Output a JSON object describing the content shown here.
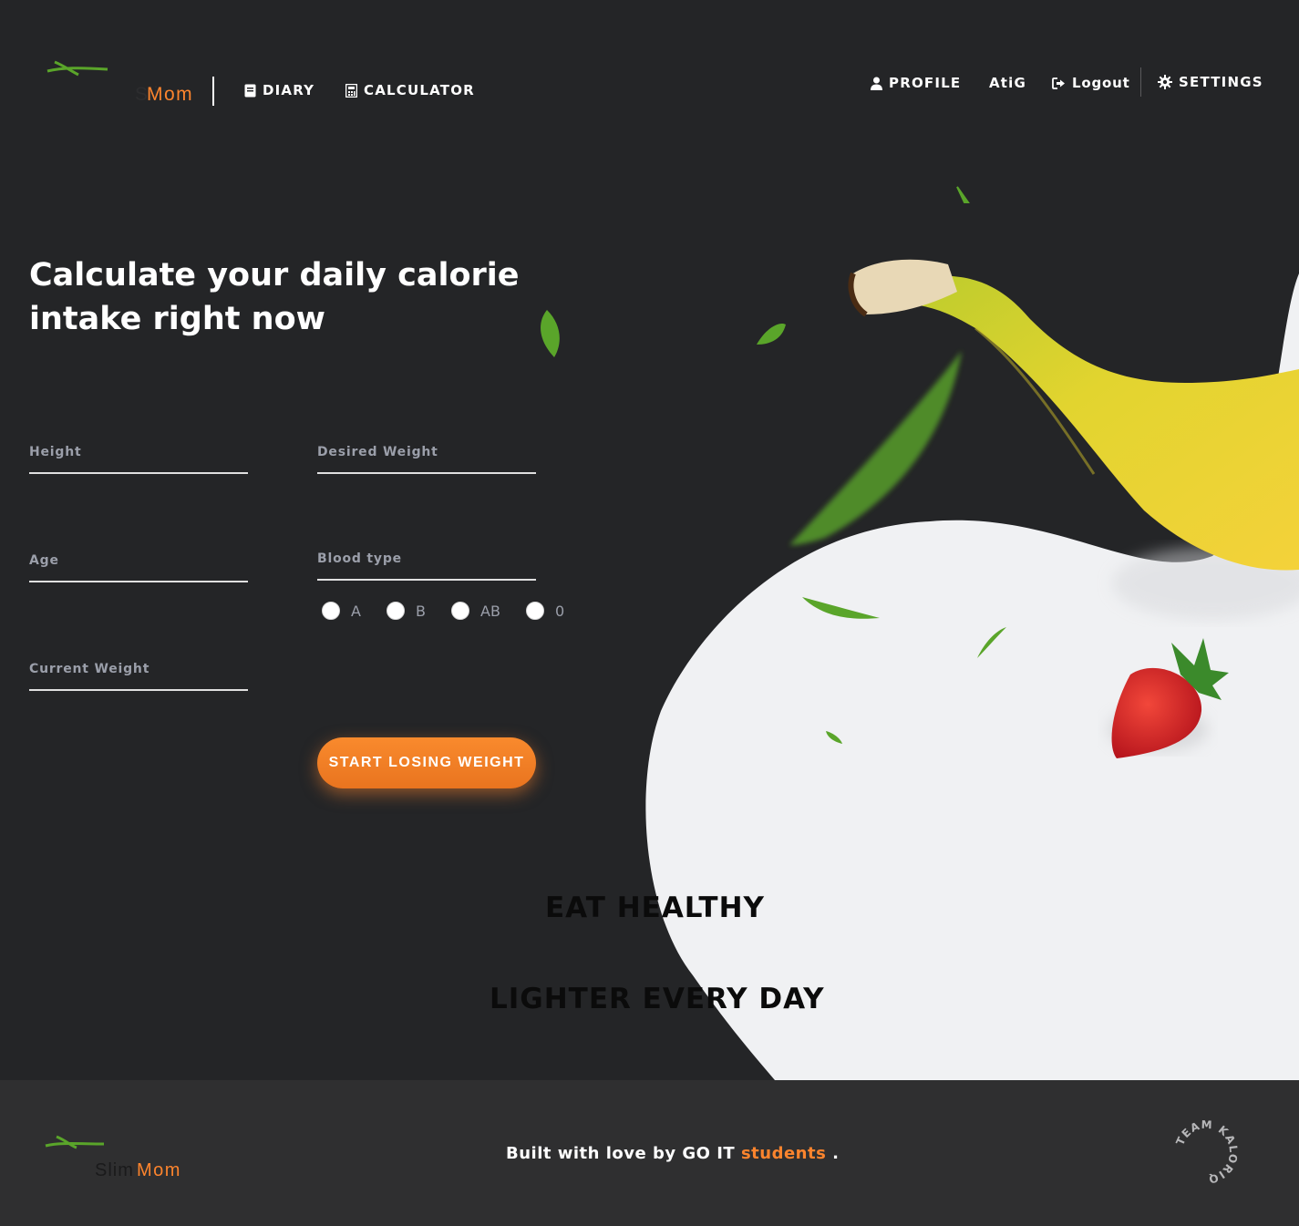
{
  "brand": {
    "slim": "Slim",
    "mom": "Mom"
  },
  "nav": {
    "diary": "DIARY",
    "calculator": "CALCULATOR",
    "profile": "PROFILE",
    "user": "AtiG",
    "logout": "Logout",
    "settings": "SETTINGS"
  },
  "main": {
    "title": "Calculate your daily calorie intake right now",
    "fields": {
      "height": "Height",
      "desired_weight": "Desired Weight",
      "age": "Age",
      "blood_type": "Blood type",
      "current_weight": "Current Weight"
    },
    "blood_options": [
      "A",
      "B",
      "AB",
      "0"
    ],
    "cta": "START LOSING WEIGHT",
    "slogan_1": "EAT HEALTHY",
    "slogan_2": "LIGHTER EVERY DAY"
  },
  "footer": {
    "built": "Built with love by GO IT ",
    "link": "students",
    "end": " .",
    "badge": "TEAM KALORIQ"
  },
  "colors": {
    "background": "#242527",
    "accent": "#fc842d",
    "blob": "#f0f1f3",
    "footer": "#2f2f30",
    "leaf": "#5aa52a"
  },
  "icons": [
    "leaf-logo-icon",
    "book-icon",
    "calculator-icon",
    "user-icon",
    "logout-icon",
    "gear-icon",
    "banana-image",
    "strawberry-image",
    "leaf-icon",
    "team-badge-icon"
  ]
}
